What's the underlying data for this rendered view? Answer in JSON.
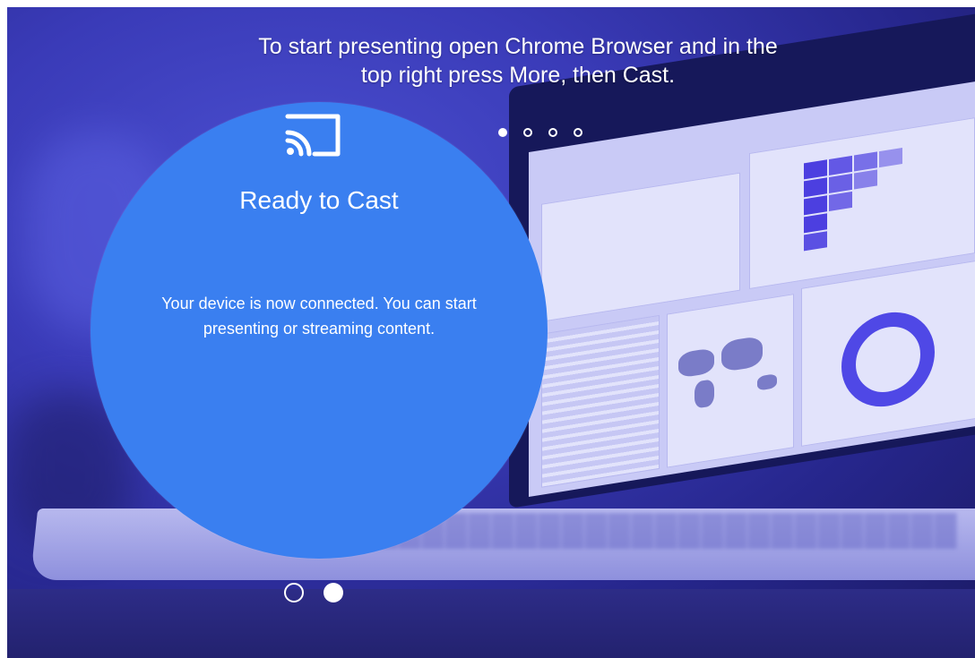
{
  "instruction": {
    "line1": "To start presenting open Chrome Browser and in the",
    "line2": "top right press More, then Cast."
  },
  "top_carousel": {
    "total": 4,
    "active_index": 0
  },
  "cast_card": {
    "icon": "cast-icon",
    "title": "Ready to Cast",
    "description_line1": "Your device is now connected. You can start",
    "description_line2": "presenting or streaming content."
  },
  "bottom_carousel": {
    "total": 2,
    "active_index": 1
  },
  "colors": {
    "background": "#3a3bb8",
    "circle": "#3a7ff0",
    "text": "#ffffff"
  }
}
